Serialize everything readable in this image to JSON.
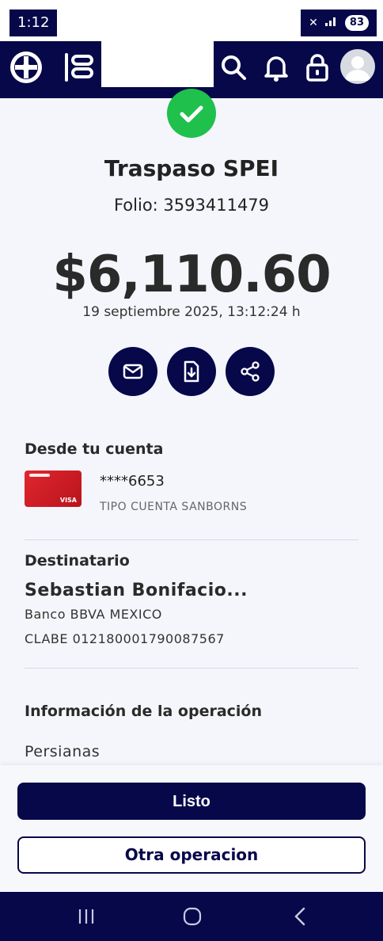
{
  "status_bar": {
    "time": "1:12",
    "battery": "83"
  },
  "transaction": {
    "title": "Traspaso SPEI",
    "folio": "Folio: 3593411479",
    "amount": "$6,110.60",
    "datetime": "19 septiembre 2025, 13:12:24 h"
  },
  "from_account": {
    "heading": "Desde tu cuenta",
    "masked_number": "****6653",
    "type": "TIPO CUENTA SANBORNS",
    "card_brand": "VISA"
  },
  "recipient": {
    "heading": "Destinatario",
    "name": "Sebastian Bonifacio...",
    "bank": "Banco BBVA MEXICO",
    "clabe": "CLABE 012180001790087567"
  },
  "operation": {
    "heading": "Información de la operación",
    "concept": "Persianas"
  },
  "buttons": {
    "done": "Listo",
    "other": "Otra operacion"
  },
  "colors": {
    "navy": "#06084a",
    "success": "#1fc04b",
    "card_red": "#d81f27"
  }
}
